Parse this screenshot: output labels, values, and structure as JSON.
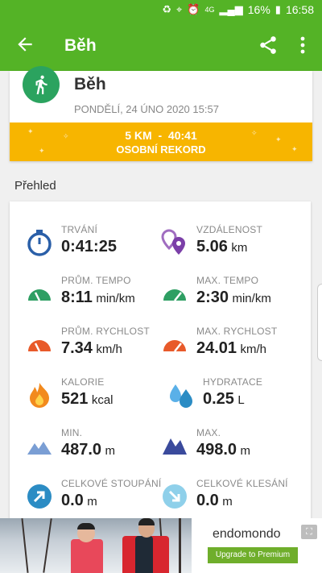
{
  "status_bar": {
    "battery": "16%",
    "time": "16:58",
    "network": "4G"
  },
  "app_bar": {
    "title": "Běh"
  },
  "workout": {
    "sport": "Běh",
    "date": "PONDĚLÍ, 24 ÚNO 2020 15:57",
    "record_line": "5 KM  -  40:41",
    "record_label": "OSOBNÍ REKORD"
  },
  "overview": {
    "title": "Přehled",
    "stats": [
      {
        "label": "TRVÁNÍ",
        "value": "0:41:25",
        "unit": "",
        "icon": "stopwatch-icon"
      },
      {
        "label": "VZDÁLENOST",
        "value": "5.06",
        "unit": "km",
        "icon": "map-pins-icon"
      },
      {
        "label": "PRŮM. TEMPO",
        "value": "8:11",
        "unit": "min/km",
        "icon": "avg-pace-gauge-icon"
      },
      {
        "label": "MAX. TEMPO",
        "value": "2:30",
        "unit": "min/km",
        "icon": "max-pace-gauge-icon"
      },
      {
        "label": "PRŮM. RYCHLOST",
        "value": "7.34",
        "unit": "km/h",
        "icon": "avg-speed-gauge-icon"
      },
      {
        "label": "MAX. RYCHLOST",
        "value": "24.01",
        "unit": "km/h",
        "icon": "max-speed-gauge-icon"
      },
      {
        "label": "KALORIE",
        "value": "521",
        "unit": "kcal",
        "icon": "flame-icon"
      },
      {
        "label": "HYDRATACE",
        "value": "0.25",
        "unit": "L",
        "icon": "water-drops-icon"
      },
      {
        "label": "MIN.",
        "value": "487.0",
        "unit": "m",
        "icon": "mountain-min-icon"
      },
      {
        "label": "MAX.",
        "value": "498.0",
        "unit": "m",
        "icon": "mountain-max-icon"
      },
      {
        "label": "CELKOVÉ STOUPÁNÍ",
        "value": "0.0",
        "unit": "m",
        "icon": "ascent-arrow-icon"
      },
      {
        "label": "CELKOVÉ KLESÁNÍ",
        "value": "0.0",
        "unit": "m",
        "icon": "descent-arrow-icon"
      }
    ]
  },
  "ad": {
    "brand": "endomondo",
    "cta": "Upgrade to Premium"
  },
  "colors": {
    "app_green": "#54b326",
    "record_yellow": "#f7b500",
    "sport_green": "#2ba35f",
    "pace_green": "#2e9f63",
    "speed_orange": "#e85a2a",
    "blue": "#2b8cc4"
  }
}
